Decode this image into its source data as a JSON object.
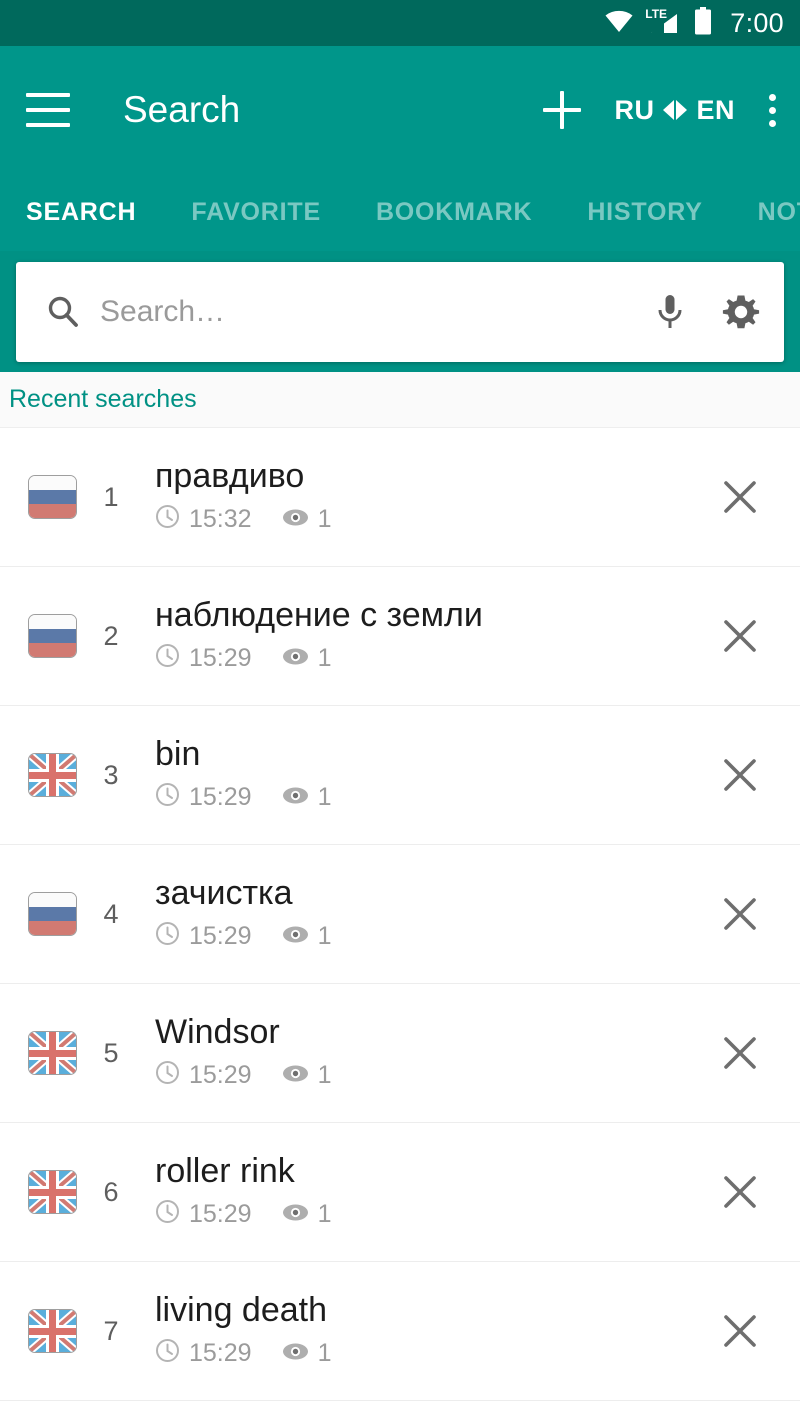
{
  "status_bar": {
    "wifi_icon": "wifi-icon",
    "network_label": "LTE",
    "signal_icon": "cellular-signal-icon",
    "battery_icon": "battery-full-icon",
    "clock": "7:00"
  },
  "app_bar": {
    "menu_icon": "hamburger-menu-icon",
    "title": "Search",
    "add_icon": "plus-icon",
    "source_lang": "RU",
    "swap_icon": "swap-languages-icon",
    "target_lang": "EN",
    "overflow_icon": "more-vertical-icon"
  },
  "tabs": [
    {
      "label": "SEARCH",
      "active": true
    },
    {
      "label": "FAVORITE",
      "active": false
    },
    {
      "label": "BOOKMARK",
      "active": false
    },
    {
      "label": "HISTORY",
      "active": false
    },
    {
      "label": "NOTE",
      "active": false
    }
  ],
  "search": {
    "search_icon": "search-icon",
    "placeholder": "Search…",
    "value": "",
    "mic_icon": "microphone-icon",
    "settings_icon": "gear-icon"
  },
  "section": {
    "title": "Recent searches"
  },
  "list": {
    "time_icon": "clock-icon",
    "views_icon": "eye-icon",
    "delete_icon": "close-icon",
    "rows": [
      {
        "flag": "ru",
        "index": "1",
        "term": "правдиво",
        "time": "15:32",
        "views": "1"
      },
      {
        "flag": "ru",
        "index": "2",
        "term": "наблюдение с земли",
        "time": "15:29",
        "views": "1"
      },
      {
        "flag": "uk",
        "index": "3",
        "term": "bin",
        "time": "15:29",
        "views": "1"
      },
      {
        "flag": "ru",
        "index": "4",
        "term": "зачистка",
        "time": "15:29",
        "views": "1"
      },
      {
        "flag": "uk",
        "index": "5",
        "term": "Windsor",
        "time": "15:29",
        "views": "1"
      },
      {
        "flag": "uk",
        "index": "6",
        "term": "roller rink",
        "time": "15:29",
        "views": "1"
      },
      {
        "flag": "uk",
        "index": "7",
        "term": "living death",
        "time": "15:29",
        "views": "1"
      }
    ]
  },
  "colors": {
    "status_bar": "#00695c",
    "app_bar": "#00968a",
    "search_band": "#009184",
    "accent": "#009184",
    "section_bg": "#fafafa",
    "flag_ru_blue": "#5b79a8",
    "flag_ru_red": "#d17a72",
    "flag_uk_blue": "#5aaedb",
    "flag_uk_red": "#d9726b"
  }
}
